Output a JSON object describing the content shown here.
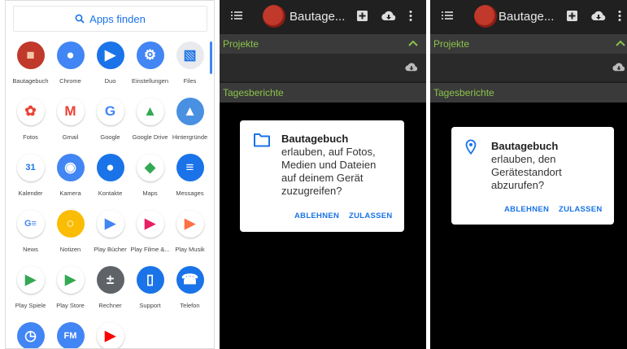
{
  "drawer": {
    "search_label": "Apps finden",
    "apps": [
      {
        "label": "Bautagebuch",
        "icon": "bautagebuch-icon",
        "color": "#c0392b"
      },
      {
        "label": "Chrome",
        "icon": "chrome-icon",
        "color": "#4285f4"
      },
      {
        "label": "Duo",
        "icon": "duo-icon",
        "color": "#1a73e8"
      },
      {
        "label": "Einstellungen",
        "icon": "settings-icon",
        "color": "#4285f4"
      },
      {
        "label": "Files",
        "icon": "files-icon",
        "color": "#e8eaed"
      },
      {
        "label": "Fotos",
        "icon": "photos-icon",
        "color": "#ffffff"
      },
      {
        "label": "Gmail",
        "icon": "gmail-icon",
        "color": "#ffffff"
      },
      {
        "label": "Google",
        "icon": "google-icon",
        "color": "#ffffff"
      },
      {
        "label": "Google Drive",
        "icon": "drive-icon",
        "color": "#ffffff"
      },
      {
        "label": "Hintergründe",
        "icon": "wallpapers-icon",
        "color": "#4a90e2"
      },
      {
        "label": "Kalender",
        "icon": "calendar-icon",
        "color": "#ffffff"
      },
      {
        "label": "Kamera",
        "icon": "camera-icon",
        "color": "#4285f4"
      },
      {
        "label": "Kontakte",
        "icon": "contacts-icon",
        "color": "#1a73e8"
      },
      {
        "label": "Maps",
        "icon": "maps-icon",
        "color": "#ffffff"
      },
      {
        "label": "Messages",
        "icon": "messages-icon",
        "color": "#1a73e8"
      },
      {
        "label": "News",
        "icon": "news-icon",
        "color": "#ffffff"
      },
      {
        "label": "Notizen",
        "icon": "keep-icon",
        "color": "#fbbc04"
      },
      {
        "label": "Play Bücher",
        "icon": "play-books-icon",
        "color": "#ffffff"
      },
      {
        "label": "Play Filme &...",
        "icon": "play-movies-icon",
        "color": "#ffffff"
      },
      {
        "label": "Play Musik",
        "icon": "play-music-icon",
        "color": "#ffffff"
      },
      {
        "label": "Play Spiele",
        "icon": "play-games-icon",
        "color": "#ffffff"
      },
      {
        "label": "Play Store",
        "icon": "play-store-icon",
        "color": "#ffffff"
      },
      {
        "label": "Rechner",
        "icon": "calculator-icon",
        "color": "#5f6368"
      },
      {
        "label": "Support",
        "icon": "support-icon",
        "color": "#1a73e8"
      },
      {
        "label": "Telefon",
        "icon": "phone-icon",
        "color": "#1a73e8"
      },
      {
        "label": "",
        "icon": "clock-icon",
        "color": "#4285f4"
      },
      {
        "label": "",
        "icon": "radio-icon",
        "color": "#4285f4"
      },
      {
        "label": "",
        "icon": "youtube-icon",
        "color": "#ffffff"
      }
    ]
  },
  "app_screen": {
    "title": "Bautage...",
    "section_projects": "Projekte",
    "section_reports": "Tagesberichte",
    "accent": "#8bc34a"
  },
  "dialog_storage": {
    "title": "Bautagebuch",
    "message_lines": [
      "erlauben, auf Fotos,",
      "Medien und Dateien",
      "auf deinem Gerät",
      "zuzugreifen?"
    ],
    "deny": "ABLEHNEN",
    "allow": "ZULASSEN",
    "icon": "folder-icon"
  },
  "dialog_location": {
    "title": "Bautagebuch",
    "message_lines": [
      "erlauben, den",
      "Gerätestandort",
      "abzurufen?"
    ],
    "deny": "ABLEHNEN",
    "allow": "ZULASSEN",
    "icon": "location-pin-icon"
  }
}
